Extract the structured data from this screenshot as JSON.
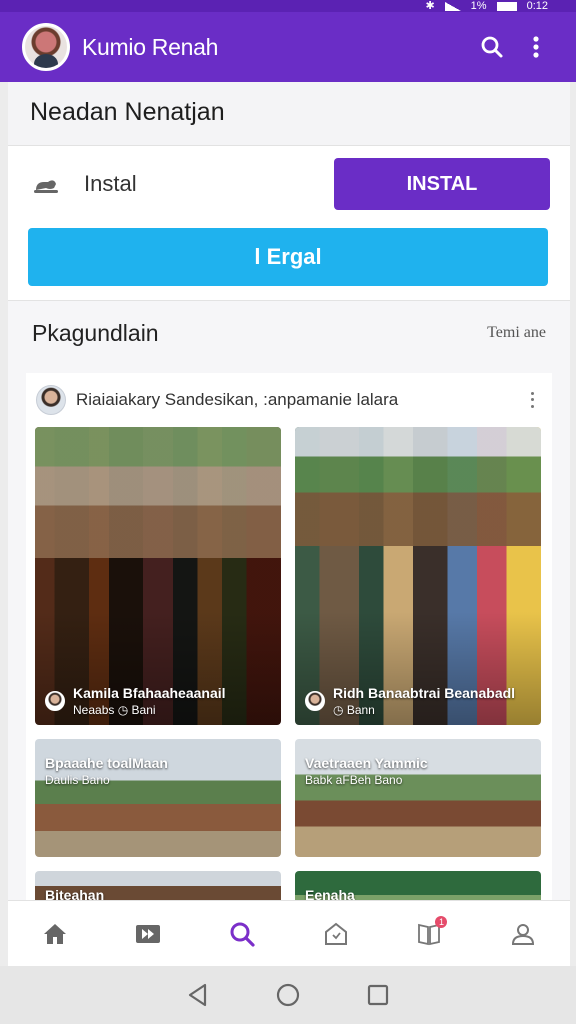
{
  "status_bar": {
    "battery": "1%",
    "time": "0:12"
  },
  "app_bar": {
    "title": "Kumio Renah"
  },
  "section": {
    "title": "Neadan Nenatjan"
  },
  "install": {
    "label": "Instal",
    "button_label": "INSTAL",
    "secondary_button_label": "l Ergal"
  },
  "feed_section": {
    "title": "Pkagundlain",
    "action_label": "Temi ane"
  },
  "post": {
    "author": "Riaiaiakary Sandesikan, :anpamanie lalara",
    "tiles": [
      {
        "title": "Kamila Bfahaaheaanail",
        "meta_left": "Neaabs",
        "meta_right": "Bani",
        "scene": "market"
      },
      {
        "title": "Ridh Banaabtrai Beanabadl",
        "meta_left": "",
        "meta_right": "Bann",
        "scene": "market"
      },
      {
        "title": "Bpaaahe toalMaan",
        "meta_left": "Daulis Bano",
        "meta_right": "",
        "scene": "village"
      },
      {
        "title": "Vaetraaen Yammic",
        "meta_left": "Babk aFBeh Bano",
        "meta_right": "",
        "scene": "village"
      },
      {
        "title": "Biteahan",
        "meta_left": "",
        "meta_right": "",
        "scene": "village"
      },
      {
        "title": "Eenaha",
        "meta_left": "",
        "meta_right": "",
        "scene": "village"
      }
    ]
  },
  "bottom_nav": {
    "items": [
      {
        "icon": "home-icon",
        "active": false
      },
      {
        "icon": "play-forward-icon",
        "active": false
      },
      {
        "icon": "search-icon",
        "active": true
      },
      {
        "icon": "house-outline-icon",
        "active": false
      },
      {
        "icon": "book-icon",
        "active": false,
        "badge": "1"
      },
      {
        "icon": "profile-icon",
        "active": false
      }
    ]
  },
  "colors": {
    "primary": "#6a2dc6",
    "accent": "#1fb2ee",
    "badge": "#e54b6a"
  }
}
